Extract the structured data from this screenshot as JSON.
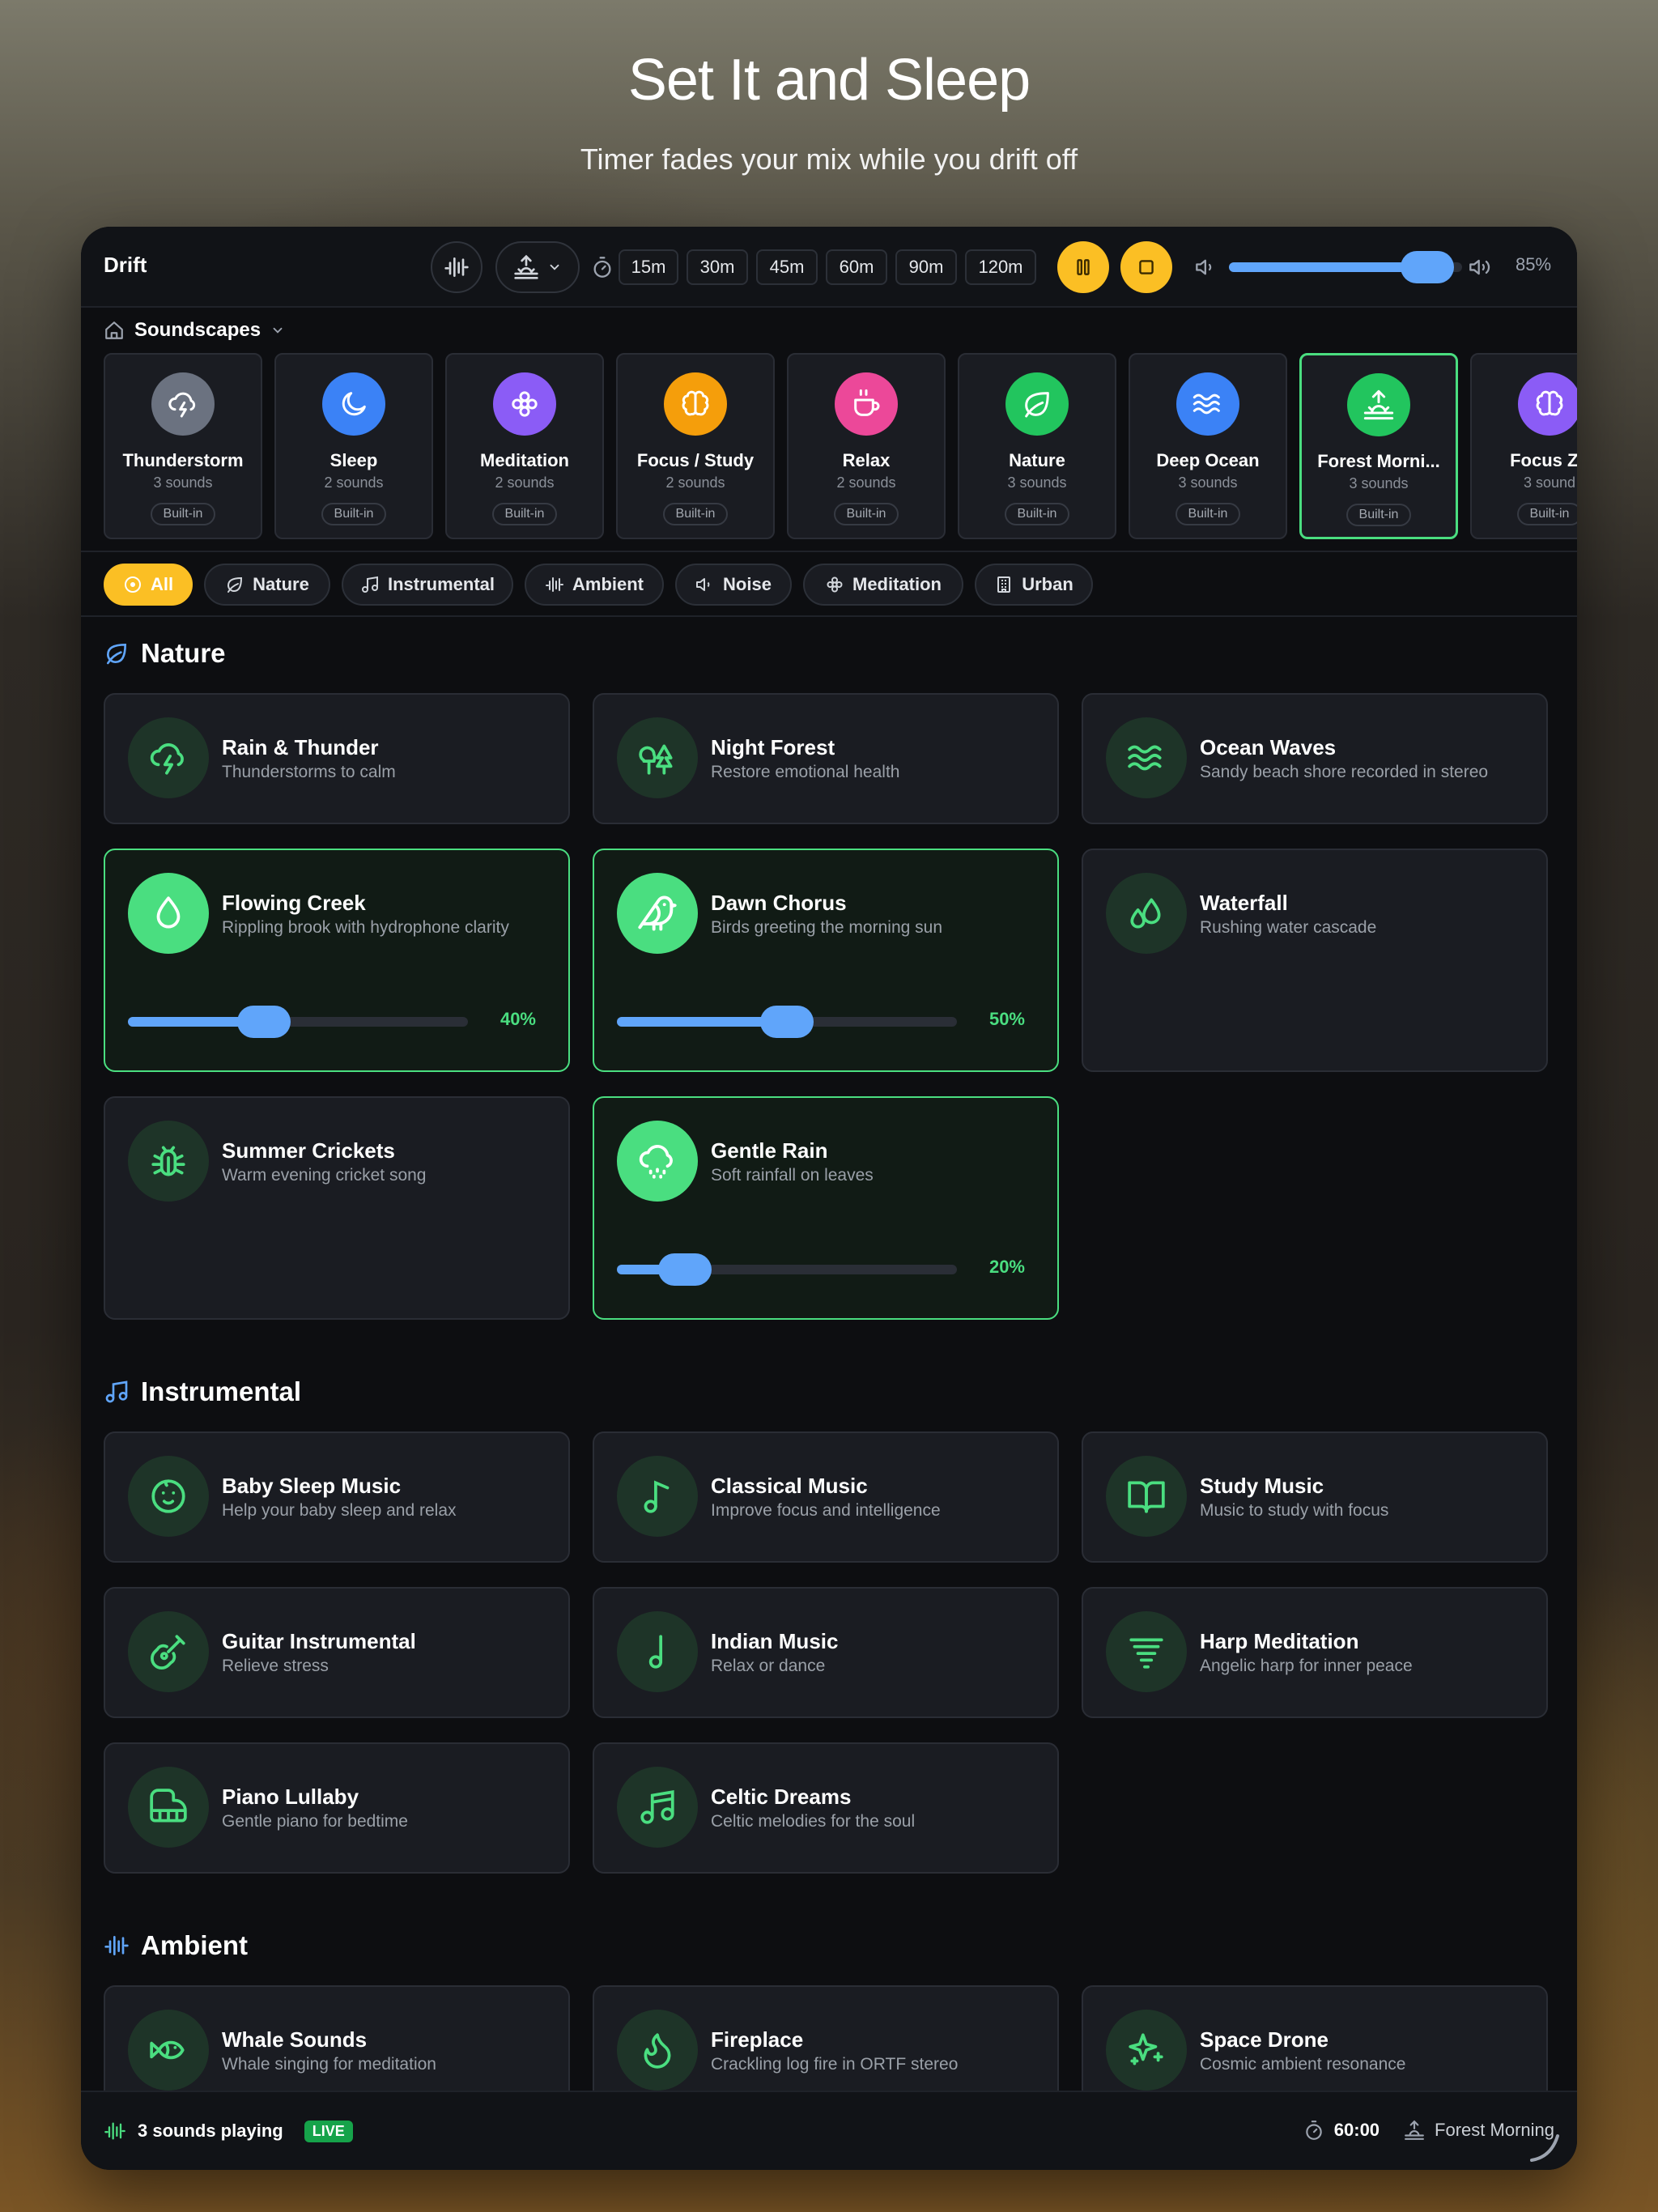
{
  "hero": {
    "title": "Set It and Sleep",
    "subtitle": "Timer fades your mix while you drift off"
  },
  "app": {
    "name": "Drift"
  },
  "toolbar": {
    "timers": [
      "15m",
      "30m",
      "45m",
      "60m",
      "90m",
      "120m"
    ],
    "volume_percent": 85,
    "volume_label": "85%"
  },
  "soundscapes": {
    "header": "Soundscapes",
    "items": [
      {
        "name": "Thunderstorm",
        "count": "3 sounds",
        "badge": "Built-in",
        "color": "#6b7280",
        "icon": "cloud-lightning-icon"
      },
      {
        "name": "Sleep",
        "count": "2 sounds",
        "badge": "Built-in",
        "color": "#3b82f6",
        "icon": "moon-icon"
      },
      {
        "name": "Meditation",
        "count": "2 sounds",
        "badge": "Built-in",
        "color": "#8b5cf6",
        "icon": "flower-icon"
      },
      {
        "name": "Focus / Study",
        "count": "2 sounds",
        "badge": "Built-in",
        "color": "#f59e0b",
        "icon": "brain-icon"
      },
      {
        "name": "Relax",
        "count": "2 sounds",
        "badge": "Built-in",
        "color": "#ec4899",
        "icon": "coffee-icon"
      },
      {
        "name": "Nature",
        "count": "3 sounds",
        "badge": "Built-in",
        "color": "#22c55e",
        "icon": "leaf-icon"
      },
      {
        "name": "Deep Ocean",
        "count": "3 sounds",
        "badge": "Built-in",
        "color": "#3b82f6",
        "icon": "waves-icon"
      },
      {
        "name": "Forest Morni...",
        "count": "3 sounds",
        "badge": "Built-in",
        "color": "#22c55e",
        "icon": "sunrise-icon",
        "active": true
      },
      {
        "name": "Focus Zo",
        "count": "3 sound",
        "badge": "Built-in",
        "color": "#8b5cf6",
        "icon": "brain-icon"
      }
    ]
  },
  "filters": [
    "All",
    "Nature",
    "Instrumental",
    "Ambient",
    "Noise",
    "Meditation",
    "Urban"
  ],
  "nature": {
    "title": "Nature",
    "items": [
      {
        "title": "Rain & Thunder",
        "subtitle": "Thunderstorms to calm"
      },
      {
        "title": "Night Forest",
        "subtitle": "Restore emotional health"
      },
      {
        "title": "Ocean Waves",
        "subtitle": "Sandy beach shore recorded in stereo"
      },
      {
        "title": "Flowing Creek",
        "subtitle": "Rippling brook with hydrophone clarity",
        "level": 40,
        "level_label": "40%"
      },
      {
        "title": "Dawn Chorus",
        "subtitle": "Birds greeting the morning sun",
        "level": 50,
        "level_label": "50%"
      },
      {
        "title": "Waterfall",
        "subtitle": "Rushing water cascade"
      },
      {
        "title": "Summer Crickets",
        "subtitle": "Warm evening cricket song"
      },
      {
        "title": "Gentle Rain",
        "subtitle": "Soft rainfall on leaves",
        "level": 20,
        "level_label": "20%"
      }
    ]
  },
  "instrumental": {
    "title": "Instrumental",
    "items": [
      {
        "title": "Baby Sleep Music",
        "subtitle": "Help your baby sleep and relax"
      },
      {
        "title": "Classical Music",
        "subtitle": "Improve focus and intelligence"
      },
      {
        "title": "Study Music",
        "subtitle": "Music to study with focus"
      },
      {
        "title": "Guitar Instrumental",
        "subtitle": "Relieve stress"
      },
      {
        "title": "Indian Music",
        "subtitle": "Relax or dance"
      },
      {
        "title": "Harp Meditation",
        "subtitle": "Angelic harp for inner peace"
      },
      {
        "title": "Piano Lullaby",
        "subtitle": "Gentle piano for bedtime"
      },
      {
        "title": "Celtic Dreams",
        "subtitle": "Celtic melodies for the soul"
      }
    ]
  },
  "ambient": {
    "title": "Ambient",
    "items": [
      {
        "title": "Whale Sounds",
        "subtitle": "Whale singing for meditation"
      },
      {
        "title": "Fireplace",
        "subtitle": "Crackling log fire in ORTF stereo"
      },
      {
        "title": "Space Drone",
        "subtitle": "Cosmic ambient resonance"
      }
    ]
  },
  "status": {
    "playing": "3 sounds playing",
    "live": "LIVE",
    "timer": "60:00",
    "scene": "Forest Morning"
  },
  "colors": {
    "accent": "#fbbf24",
    "active": "#4ade80",
    "slider": "#60a5fa"
  }
}
